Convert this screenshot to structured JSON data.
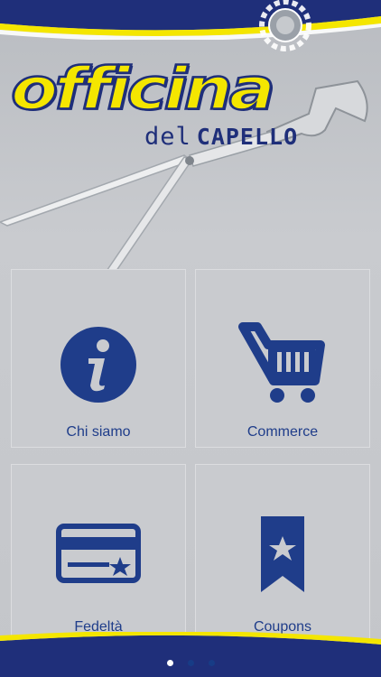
{
  "brand": {
    "title": "officina",
    "sub_del": "del",
    "sub_capello": "CAPELLO",
    "colors": {
      "yellow": "#f4e600",
      "navy": "#1f2f7a",
      "tile_blue": "#1f3d8a"
    }
  },
  "tiles": [
    {
      "label": "Chi siamo",
      "icon": "info-icon"
    },
    {
      "label": "Commerce",
      "icon": "shopping-cart-icon"
    },
    {
      "label": "Fedeltà",
      "icon": "loyalty-card-icon"
    },
    {
      "label": "Coupons",
      "icon": "coupon-ribbon-icon"
    }
  ],
  "pager": {
    "pages": 3,
    "active_index": 0
  }
}
